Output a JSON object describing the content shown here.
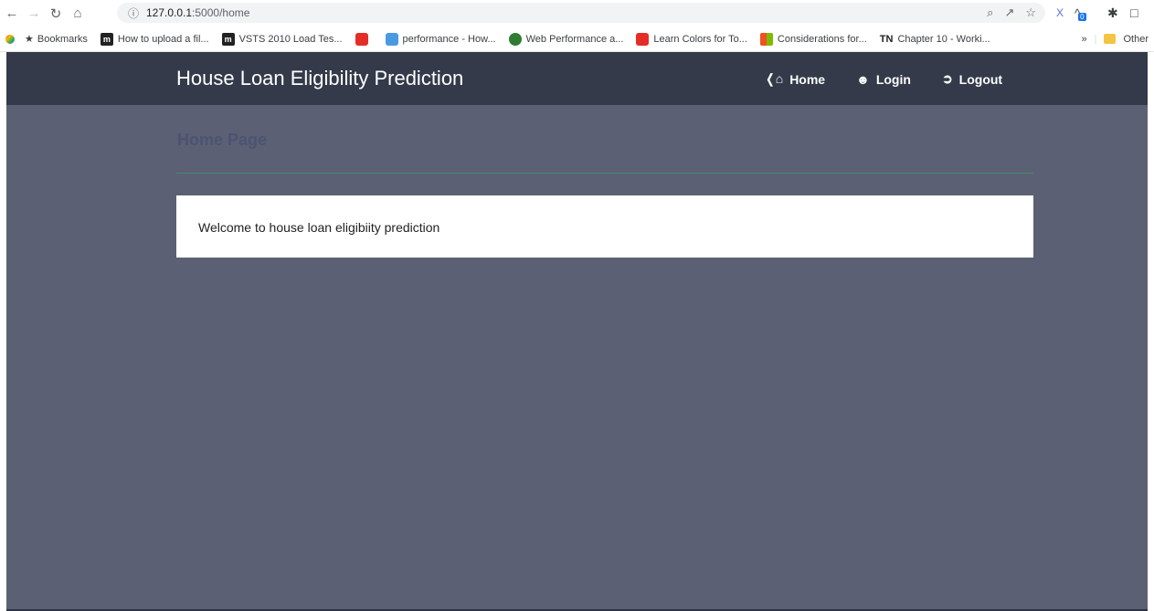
{
  "browser": {
    "url_host": "127.0.0.1",
    "url_path": ":5000/home",
    "bookmarks_label": "Bookmarks",
    "other_label": "Other",
    "overflow_label": "»",
    "extension_badge": "0",
    "bookmark_items": [
      {
        "label": "How to upload a fil...",
        "icon": "m"
      },
      {
        "label": "VSTS 2010 Load Tes...",
        "icon": "m"
      },
      {
        "label": "performance - How...",
        "icon": ""
      },
      {
        "label": "Web Performance a...",
        "icon": ""
      },
      {
        "label": "Learn Colors for To...",
        "icon": ""
      },
      {
        "label": "Considerations for...",
        "icon": ""
      },
      {
        "label": "Chapter 10 - Worki...",
        "icon": "TN"
      }
    ]
  },
  "app": {
    "brand": "House Loan Eligibility Prediction",
    "nav": {
      "home": "Home",
      "login": "Login",
      "logout": "Logout"
    },
    "page_title": "Home Page",
    "welcome_text": "Welcome to house loan eligibiity prediction"
  },
  "colors": {
    "navbar": "#343a4a",
    "page_bg": "#5c6074",
    "rule": "#3f8a6e"
  }
}
